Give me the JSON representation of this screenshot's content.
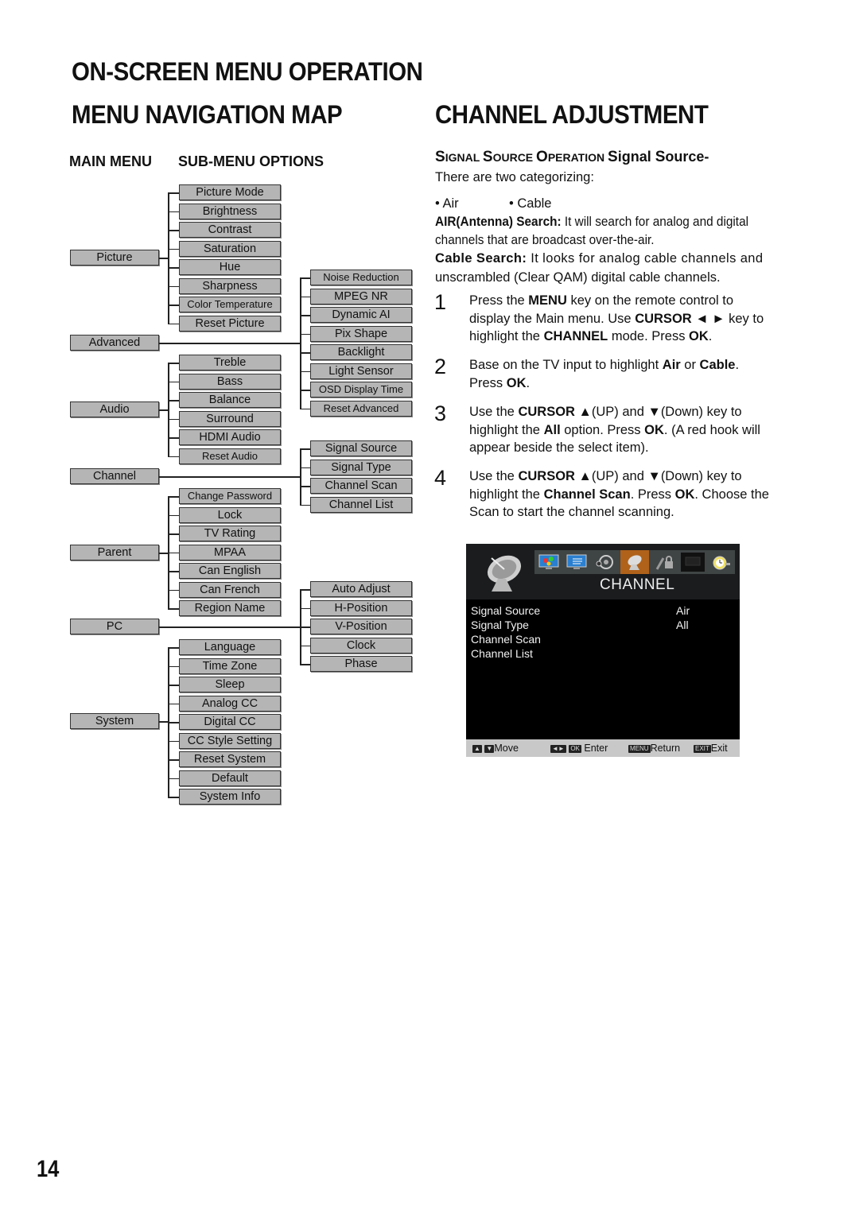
{
  "headings": {
    "page_title": "ON-SCREEN MENU OPERATION",
    "left_title": "MENU NAVIGATION MAP",
    "right_title": "CHANNEL ADJUSTMENT",
    "col_main": "MAIN MENU",
    "col_sub": "SUB-MENU OPTIONS"
  },
  "menu_map": {
    "picture": {
      "label": "Picture",
      "items": [
        "Picture Mode",
        "Brightness",
        "Contrast",
        "Saturation",
        "Hue",
        "Sharpness",
        "Color Temperature",
        "Reset Picture"
      ]
    },
    "advanced": {
      "label": "Advanced",
      "items": [
        "Noise Reduction",
        "MPEG NR",
        "Dynamic AI",
        "Pix Shape",
        "Backlight",
        "Light Sensor",
        "OSD Display Time",
        "Reset Advanced"
      ]
    },
    "audio": {
      "label": "Audio",
      "items": [
        "Treble",
        "Bass",
        "Balance",
        "Surround",
        "HDMI Audio",
        "Reset Audio"
      ]
    },
    "channel": {
      "label": "Channel",
      "items": [
        "Signal Source",
        "Signal Type",
        "Channel Scan",
        "Channel List"
      ]
    },
    "parent": {
      "label": "Parent",
      "items": [
        "Change Password",
        "Lock",
        "TV Rating",
        "MPAA",
        "Can English",
        "Can French",
        "Region Name"
      ]
    },
    "pc": {
      "label": "PC",
      "items": [
        "Auto Adjust",
        "H-Position",
        "V-Position",
        "Clock",
        "Phase"
      ]
    },
    "system": {
      "label": "System",
      "items": [
        "Language",
        "Time Zone",
        "Sleep",
        "Analog CC",
        "Digital CC",
        "CC Style Setting",
        "Reset System",
        "Default",
        "System Info"
      ]
    }
  },
  "channel_adjustment": {
    "section_heading": "Signal Source Operation Signal Source-",
    "intro": "There are two categorizing:",
    "bullet_air": "• Air",
    "bullet_cable": "• Cable",
    "air_label": "AIR(Antenna) Search:",
    "air_text_1": " It will search for analog and digital",
    "air_text_2": "channels that are broadcast over-the-air.",
    "cable_label": "Cable Search:",
    "cable_text_1": " It looks for analog cable channels and",
    "cable_text_2": "unscrambled (Clear QAM) digital cable channels.",
    "steps": [
      {
        "num": "1",
        "parts": [
          "Press the ",
          "MENU",
          " key on the remote control to display the Main menu. Use ",
          "CURSOR ◄ ►",
          " key to highlight the ",
          "CHANNEL",
          " mode. Press ",
          "OK",
          "."
        ]
      },
      {
        "num": "2",
        "parts": [
          "Base on the TV input to highlight ",
          "Air",
          " or ",
          "Cable",
          ". Press ",
          "OK",
          "."
        ]
      },
      {
        "num": "3",
        "parts": [
          "Use the ",
          "CURSOR ▲",
          "(UP) and ▼(Down) key to highlight the ",
          "All",
          " option. Press ",
          "OK",
          ". (A red hook will appear beside the select item)."
        ]
      },
      {
        "num": "4",
        "parts": [
          "Use the ",
          "CURSOR ▲",
          "(UP) and ▼(Down) key to highlight the ",
          "Channel Scan",
          ". Press ",
          "OK",
          ". Choose the Scan to start the channel scanning."
        ]
      }
    ]
  },
  "osd": {
    "title": "CHANNEL",
    "icons": [
      "picture-icon",
      "advanced-icon",
      "audio-icon",
      "channel-icon",
      "parent-lock-icon",
      "pc-icon",
      "system-clock-icon"
    ],
    "selected_icon_index": 3,
    "selected_color": "#b0621a",
    "rows": [
      {
        "label": "Signal Source",
        "value": "Air"
      },
      {
        "label": "Signal Type",
        "value": "All"
      },
      {
        "label": "Channel Scan",
        "value": ""
      },
      {
        "label": "Channel List",
        "value": ""
      }
    ],
    "footer": {
      "move": "Move",
      "enter": "Enter",
      "return": "Return",
      "exit": "Exit",
      "ok_key": "OK",
      "menu_key": "MENU",
      "exit_key": "EXIT"
    }
  },
  "page_number": "14"
}
